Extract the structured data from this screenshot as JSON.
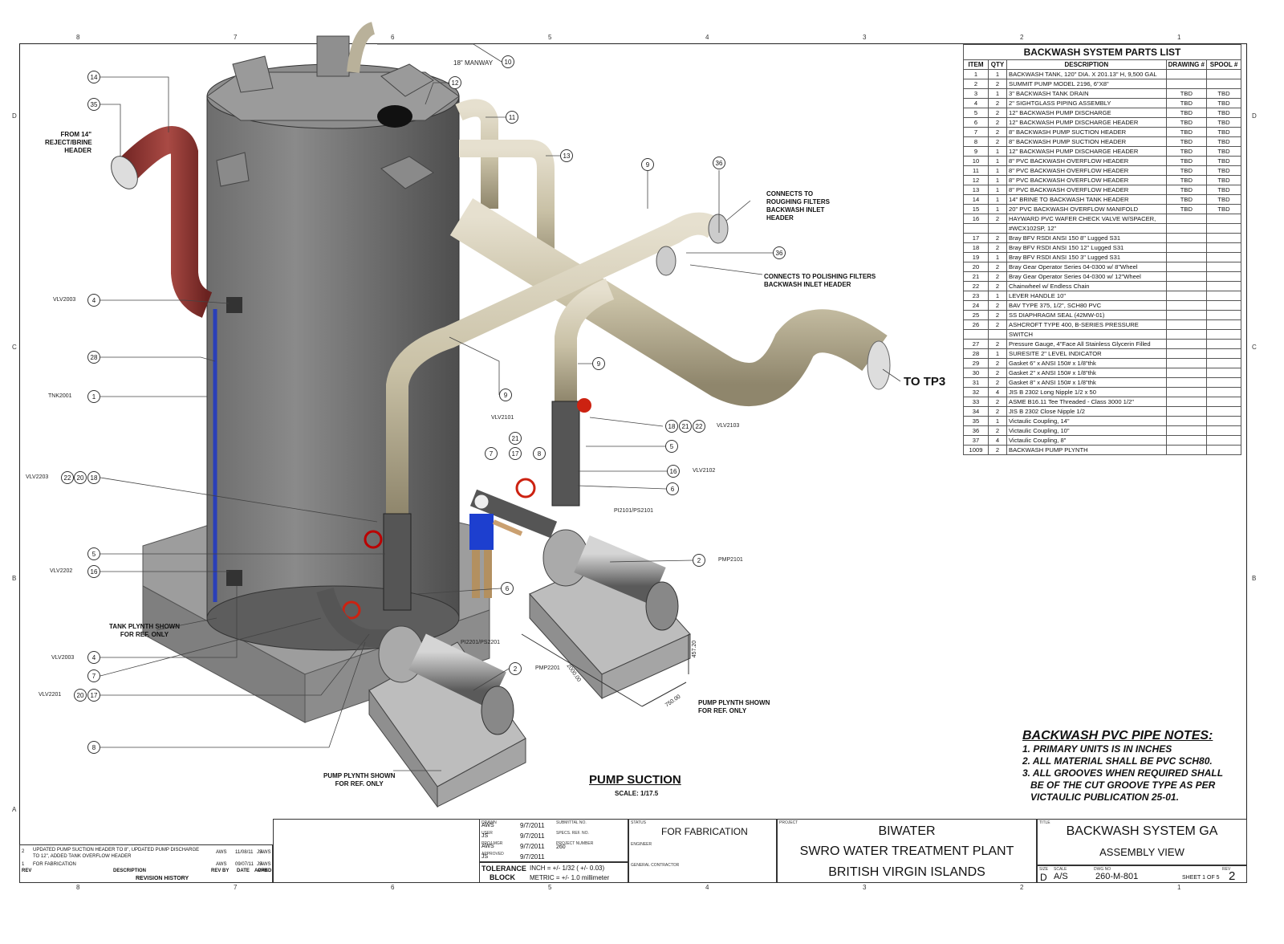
{
  "zones": {
    "top_numbers": [
      "8",
      "7",
      "6",
      "5",
      "4",
      "3",
      "2",
      "1"
    ],
    "side_letters": [
      "D",
      "C",
      "B",
      "A"
    ]
  },
  "parts_list": {
    "title": "BACKWASH SYSTEM PARTS LIST",
    "columns": [
      "ITEM",
      "QTY",
      "DESCRIPTION",
      "DRAWING #",
      "SPOOL #"
    ],
    "rows": [
      [
        "1",
        "1",
        "BACKWASH TANK, 120\" DIA. X 201.13\" H, 9,500 GAL",
        "",
        ""
      ],
      [
        "2",
        "2",
        "SUMMIT PUMP MODEL 2196, 6\"X8\"",
        "",
        ""
      ],
      [
        "3",
        "1",
        "3\" BACKWASH TANK DRAIN",
        "TBD",
        "TBD"
      ],
      [
        "4",
        "2",
        "2\" SIGHTGLASS PIPING ASSEMBLY",
        "TBD",
        "TBD"
      ],
      [
        "5",
        "2",
        "12\" BACKWASH PUMP DISCHARGE",
        "TBD",
        "TBD"
      ],
      [
        "6",
        "2",
        "12\" BACKWASH PUMP DISCHARGE HEADER",
        "TBD",
        "TBD"
      ],
      [
        "7",
        "2",
        "8\" BACKWASH PUMP SUCTION HEADER",
        "TBD",
        "TBD"
      ],
      [
        "8",
        "2",
        "8\" BACKWASH PUMP SUCTION HEADER",
        "TBD",
        "TBD"
      ],
      [
        "9",
        "1",
        "12\" BACKWASH PUMP DISCHARGE HEADER",
        "TBD",
        "TBD"
      ],
      [
        "10",
        "1",
        "8\" PVC BACKWASH OVERFLOW HEADER",
        "TBD",
        "TBD"
      ],
      [
        "11",
        "1",
        "8\" PVC BACKWASH OVERFLOW HEADER",
        "TBD",
        "TBD"
      ],
      [
        "12",
        "1",
        "8\" PVC BACKWASH OVERFLOW HEADER",
        "TBD",
        "TBD"
      ],
      [
        "13",
        "1",
        "8\" PVC BACKWASH OVERFLOW HEADER",
        "TBD",
        "TBD"
      ],
      [
        "14",
        "1",
        "14\" BRINE TO BACKWASH TANK HEADER",
        "TBD",
        "TBD"
      ],
      [
        "15",
        "1",
        "20\" PVC BACKWASH OVERFLOW MANIFOLD",
        "TBD",
        "TBD"
      ],
      [
        "16",
        "2",
        "HAYWARD PVC WAFER CHECK VALVE W/SPACER,",
        "",
        ""
      ],
      [
        "",
        "",
        "#WCX102SP, 12\"",
        "",
        ""
      ],
      [
        "17",
        "2",
        "Bray BFV RSDI ANSI 150 8\" Lugged S31",
        "",
        ""
      ],
      [
        "18",
        "2",
        "Bray BFV RSDI ANSI 150 12\" Lugged S31",
        "",
        ""
      ],
      [
        "19",
        "1",
        "Bray BFV RSDI ANSI 150 3\" Lugged S31",
        "",
        ""
      ],
      [
        "20",
        "2",
        "Bray Gear Operator Series 04-0300 w/ 8\"Wheel",
        "",
        ""
      ],
      [
        "21",
        "2",
        "Bray Gear Operator Series 04-0300 w/ 12\"Wheel",
        "",
        ""
      ],
      [
        "22",
        "2",
        "Chainwheel w/ Endless Chain",
        "",
        ""
      ],
      [
        "23",
        "1",
        "LEVER HANDLE 10\"",
        "",
        ""
      ],
      [
        "24",
        "2",
        "BAV TYPE 375, 1/2\", SCH80 PVC",
        "",
        ""
      ],
      [
        "25",
        "2",
        "SS DIAPHRAGM SEAL (42MW-01)",
        "",
        ""
      ],
      [
        "26",
        "2",
        "ASHCROFT TYPE 400, B-SERIES PRESSURE",
        "",
        ""
      ],
      [
        "",
        "",
        "SWITCH",
        "",
        ""
      ],
      [
        "27",
        "2",
        "Pressure Gauge, 4\"Face All Stainless Glycerin Filled",
        "",
        ""
      ],
      [
        "28",
        "1",
        "SURESITE 2\" LEVEL INDICATOR",
        "",
        ""
      ],
      [
        "29",
        "2",
        "Gasket 6\" x ANSI 150# x 1/8\"thk",
        "",
        ""
      ],
      [
        "30",
        "2",
        "Gasket 2\" x ANSI 150# x 1/8\"thk",
        "",
        ""
      ],
      [
        "31",
        "2",
        "Gasket 8\" x ANSI 150# x 1/8\"thk",
        "",
        ""
      ],
      [
        "32",
        "4",
        "JIS B 2302 Long Nipple 1/2 x 50",
        "",
        ""
      ],
      [
        "33",
        "2",
        "ASME B16.11 Tee Threaded - Class 3000 1/2\"",
        "",
        ""
      ],
      [
        "34",
        "2",
        "JIS B 2302 Close Nipple 1/2",
        "",
        ""
      ],
      [
        "35",
        "1",
        "Victaulic Coupling, 14\"",
        "",
        ""
      ],
      [
        "36",
        "2",
        "Victaulic Coupling, 10\"",
        "",
        ""
      ],
      [
        "37",
        "4",
        "Victaulic Coupling, 8\"",
        "",
        ""
      ],
      [
        "1009",
        "2",
        "BACKWASH PUMP PLYNTH",
        "",
        ""
      ]
    ]
  },
  "annotations": {
    "manway": "18\" MANWAY",
    "from_reject": [
      "FROM 14\"",
      "REJECT/BRINE",
      "HEADER"
    ],
    "roughing": [
      "CONNECTS TO",
      "ROUGHING FILTERS",
      "BACKWASH INLET",
      "HEADER"
    ],
    "polishing": [
      "CONNECTS TO POLISHING FILTERS",
      "BACKWASH INLET HEADER"
    ],
    "to_tp3": "TO TP3",
    "tank_plynth": [
      "TANK PLYNTH SHOWN",
      "FOR REF. ONLY"
    ],
    "pump_plynth_right": [
      "PUMP PLYNTH SHOWN",
      "FOR REF. ONLY"
    ],
    "pump_plynth_left": [
      "PUMP PLYNTH SHOWN",
      "FOR REF. ONLY"
    ],
    "dim_1": "2000.00",
    "dim_2": "750.00",
    "dim_3": "457.20",
    "view_title": "PUMP SUCTION",
    "view_scale": "SCALE: 1/17.5"
  },
  "tags": {
    "vlv2003_top": "VLV2003",
    "tnk2001": "TNK2001",
    "vlv2203": "VLV2203",
    "vlv2202": "VLV2202",
    "vlv2003_bot": "VLV2003",
    "vlv2201": "VLV2201",
    "vlv2101": "VLV2101",
    "vlv2103": "VLV2103",
    "vlv2102": "VLV2102",
    "pi2101": "PI2101/PS2101",
    "pi2201": "PI2201/PS2201",
    "pmp2101": "PMP2101",
    "pmp2201": "PMP2201"
  },
  "callouts": {
    "c14": "14",
    "c35": "35",
    "c4a": "4",
    "c28": "28",
    "c1": "1",
    "c22a": "22",
    "c20a": "20",
    "c18a": "18",
    "c5a": "5",
    "c16a": "16",
    "c4b": "4",
    "c7a": "7",
    "c20b": "20",
    "c17a": "17",
    "c8a": "8",
    "c10": "10",
    "c12": "12",
    "c11": "11",
    "c13": "13",
    "c9a": "9",
    "c36a": "36",
    "c36b": "36",
    "c9b": "9",
    "c9c": "9",
    "c21": "21",
    "c7b": "7",
    "c17b": "17",
    "c8b": "8",
    "c18b": "18",
    "c21b": "21",
    "c22b": "22",
    "c5b": "5",
    "c16b": "16",
    "c6a": "6",
    "c2a": "2",
    "c6b": "6",
    "c2b": "2"
  },
  "pipe_notes": {
    "title": "BACKWASH PVC PIPE NOTES:",
    "lines": [
      "1. PRIMARY UNITS IS IN INCHES",
      "2. ALL MATERIAL SHALL BE PVC SCH80.",
      "3. ALL GROOVES WHEN REQUIRED SHALL",
      "   BE OF THE CUT GROOVE TYPE AS PER",
      "   VICTAULIC PUBLICATION 25-01."
    ]
  },
  "revisions": {
    "rows": [
      [
        "2",
        "UPDATED PUMP SUCTION HEADER TO 8\", UPDATED PUMP DISCHARGE TO 12\", ADDED TANK OVERFLOW HEADER",
        "AWS",
        "11/08/11",
        "AWS",
        "JS"
      ],
      [
        "1",
        "FOR FABRICATION",
        "AWS",
        "09/07/11",
        "AWS",
        "JS"
      ]
    ],
    "headers": [
      "REV",
      "DESCRIPTION",
      "REV BY",
      "DATE",
      "CHKD",
      "APPD"
    ],
    "title": "REVISION HISTORY"
  },
  "title_block": {
    "drawn_label": "DRAWN",
    "drawn": "AWS",
    "drawn_date": "9/7/2011",
    "user_label": "USER",
    "user": "JS",
    "user_date": "9/7/2011",
    "proj_mgr_label": "PROJ MGR",
    "proj_mgr": "AWS",
    "proj_mgr_date": "9/7/2011",
    "approved_label": "APPROVED",
    "approved": "JS",
    "approved_date": "9/7/2011",
    "submittal_label": "SUBMITTAL NO.",
    "specs_label": "SPECS. REF. NO.",
    "project_number_label": "PROJECT NUMBER",
    "project_number": "260",
    "tolerance_label_1": "TOLERANCE",
    "tolerance_label_2": "BLOCK",
    "tolerance_inch": "INCH = +/- 1/32 ( +/- 0.03)",
    "tolerance_metric": "METRIC = +/- 1.0 millimeter",
    "status_label": "STATUS",
    "status": "FOR FABRICATION",
    "engineer_label": "ENGINEER",
    "contractor_label": "GENERAL CONTRACTOR",
    "project_label": "PROJECT",
    "project_1": "BIWATER",
    "project_2": "SWRO WATER TREATMENT PLANT",
    "project_3": "BRITISH VIRGIN ISLANDS",
    "title_label": "TITLE",
    "title_1": "BACKWASH SYSTEM GA",
    "title_2": "ASSEMBLY VIEW",
    "size_label": "SIZE",
    "size": "D",
    "scale_label": "SCALE",
    "scale": "A/S",
    "dwg_label": "DWG NO",
    "dwg": "260-M-801",
    "sheet": "SHEET 1  OF 5",
    "rev_label": "REV",
    "rev": "2"
  }
}
